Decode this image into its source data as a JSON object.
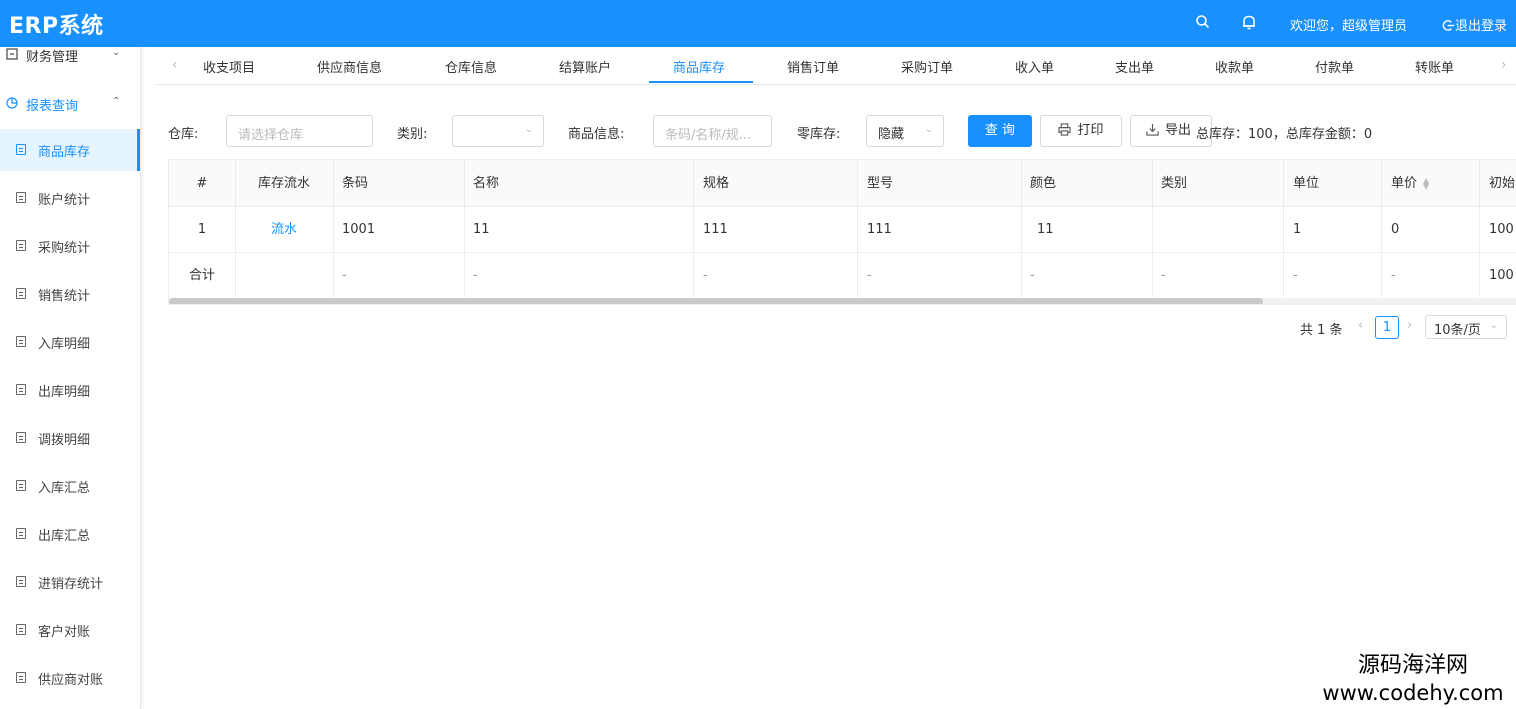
{
  "header": {
    "title": "ERP系统",
    "welcome": "欢迎您，超级管理员",
    "logout": "退出登录",
    "icons": [
      "search-icon",
      "bell-icon",
      "logout-icon"
    ],
    "accent_color": "#1890ff"
  },
  "sidebar": {
    "groups": [
      {
        "label": "财务管理",
        "icon": "finance-icon",
        "expanded": false
      },
      {
        "label": "报表查询",
        "icon": "pie-chart-icon",
        "expanded": true
      }
    ],
    "items": [
      {
        "label": "商品库存",
        "active": true
      },
      {
        "label": "账户统计"
      },
      {
        "label": "采购统计"
      },
      {
        "label": "销售统计"
      },
      {
        "label": "入库明细"
      },
      {
        "label": "出库明细"
      },
      {
        "label": "调拨明细"
      },
      {
        "label": "入库汇总"
      },
      {
        "label": "出库汇总"
      },
      {
        "label": "进销存统计"
      },
      {
        "label": "客户对账"
      },
      {
        "label": "供应商对账"
      }
    ]
  },
  "tabs": [
    "收支项目",
    "供应商信息",
    "仓库信息",
    "结算账户",
    "商品库存",
    "销售订单",
    "采购订单",
    "收入单",
    "支出单",
    "收款单",
    "付款单",
    "转账单"
  ],
  "active_tab": "商品库存",
  "filters": {
    "warehouse_label": "仓库:",
    "warehouse_placeholder": "请选择仓库",
    "category_label": "类别:",
    "category_value": "",
    "goods_label": "商品信息:",
    "goods_placeholder": "条码/名称/规...",
    "zero_stock_label": "零库存:",
    "zero_stock_value": "隐藏",
    "query_button": "查 询",
    "print_button": "打印",
    "export_button": "导出",
    "summary": "总库存：100，总库存金额：0"
  },
  "table": {
    "columns": [
      "#",
      "库存流水",
      "条码",
      "名称",
      "规格",
      "型号",
      "颜色",
      "类别",
      "单位",
      "单价",
      "初始"
    ],
    "rows": [
      [
        "1",
        "流水",
        "1001",
        "11",
        "111",
        "111",
        "11",
        "",
        "1",
        "0",
        "100"
      ]
    ],
    "total_row": [
      "合计",
      "",
      "-",
      "-",
      "-",
      "-",
      "-",
      "-",
      "-",
      "-",
      "100"
    ]
  },
  "pagination": {
    "total": "共 1 条",
    "current": "1",
    "page_size": "10条/页"
  },
  "watermark": {
    "line1": "源码海洋网",
    "line2": "www.codehy.com"
  }
}
